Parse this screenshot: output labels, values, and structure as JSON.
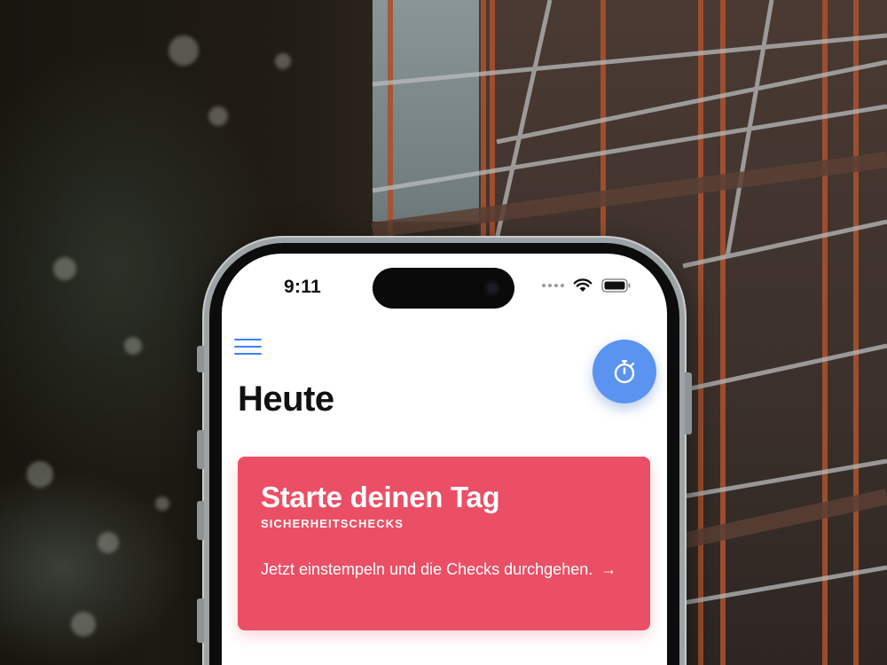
{
  "status_bar": {
    "time": "9:11"
  },
  "app": {
    "page_title": "Heute",
    "menu_icon": "hamburger-menu-icon",
    "timer_icon": "stopwatch-icon",
    "accent_color": "#3b82f6"
  },
  "card": {
    "title": "Starte deinen Tag",
    "subtitle": "SICHERHEITSCHECKS",
    "body": "Jetzt einstempeln und die Checks durchgehen.",
    "arrow": "→",
    "color": "#ea4f65"
  }
}
